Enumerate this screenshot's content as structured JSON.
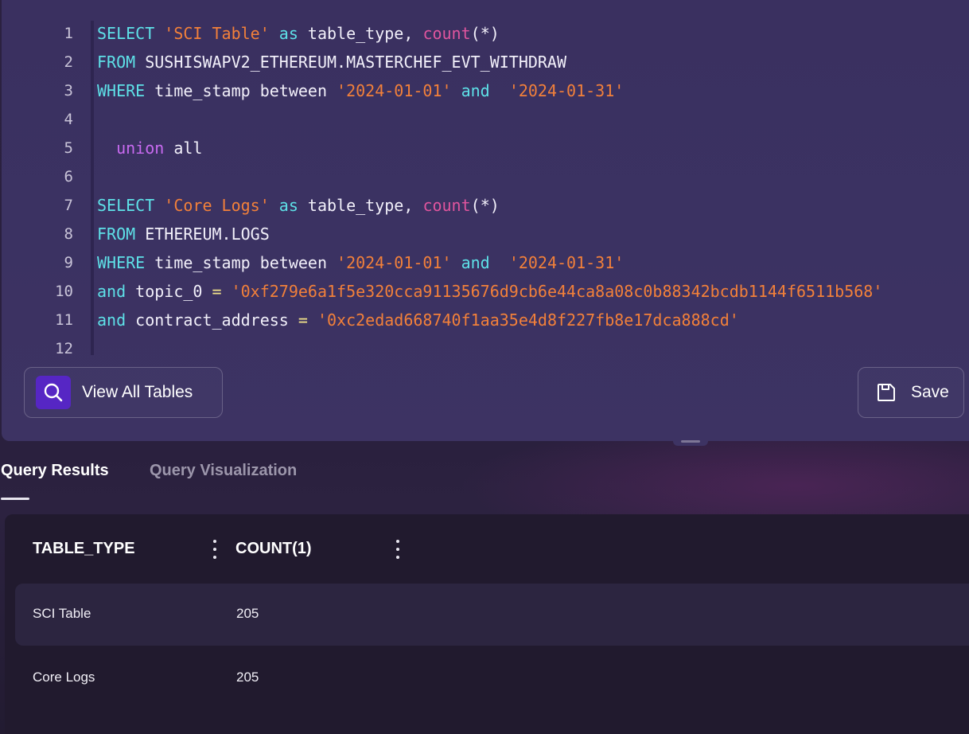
{
  "editor": {
    "lines": [
      {
        "n": "1",
        "tokens": [
          {
            "t": "SELECT",
            "c": "kw"
          },
          {
            "t": " "
          },
          {
            "t": "'SCI Table'",
            "c": "str"
          },
          {
            "t": " "
          },
          {
            "t": "as",
            "c": "kw"
          },
          {
            "t": " table_type, "
          },
          {
            "t": "count",
            "c": "fn"
          },
          {
            "t": "(*)"
          }
        ]
      },
      {
        "n": "2",
        "tokens": [
          {
            "t": "FROM",
            "c": "kw"
          },
          {
            "t": " SUSHISWAPV2_ETHEREUM.MASTERCHEF_EVT_WITHDRAW"
          }
        ]
      },
      {
        "n": "3",
        "tokens": [
          {
            "t": "WHERE",
            "c": "kw"
          },
          {
            "t": " time_stamp between "
          },
          {
            "t": "'2024-01-01'",
            "c": "str"
          },
          {
            "t": " "
          },
          {
            "t": "and",
            "c": "kw"
          },
          {
            "t": "  "
          },
          {
            "t": "'2024-01-31'",
            "c": "str"
          }
        ]
      },
      {
        "n": "4",
        "tokens": []
      },
      {
        "n": "5",
        "tokens": [
          {
            "t": "  "
          },
          {
            "t": "union",
            "c": "un"
          },
          {
            "t": " all"
          }
        ]
      },
      {
        "n": "6",
        "tokens": []
      },
      {
        "n": "7",
        "tokens": [
          {
            "t": "SELECT",
            "c": "kw"
          },
          {
            "t": " "
          },
          {
            "t": "'Core Logs'",
            "c": "str"
          },
          {
            "t": " "
          },
          {
            "t": "as",
            "c": "kw"
          },
          {
            "t": " table_type, "
          },
          {
            "t": "count",
            "c": "fn"
          },
          {
            "t": "(*)"
          }
        ]
      },
      {
        "n": "8",
        "tokens": [
          {
            "t": "FROM",
            "c": "kw"
          },
          {
            "t": " ETHEREUM.LOGS"
          }
        ]
      },
      {
        "n": "9",
        "tokens": [
          {
            "t": "WHERE",
            "c": "kw"
          },
          {
            "t": " time_stamp between "
          },
          {
            "t": "'2024-01-01'",
            "c": "str"
          },
          {
            "t": " "
          },
          {
            "t": "and",
            "c": "kw"
          },
          {
            "t": "  "
          },
          {
            "t": "'2024-01-31'",
            "c": "str"
          }
        ]
      },
      {
        "n": "10",
        "tokens": [
          {
            "t": "and",
            "c": "kw"
          },
          {
            "t": " topic_0 "
          },
          {
            "t": "=",
            "c": "op"
          },
          {
            "t": " "
          },
          {
            "t": "'0xf279e6a1f5e320cca91135676d9cb6e44ca8a08c0b88342bcdb1144f6511b568'",
            "c": "str"
          }
        ]
      },
      {
        "n": "11",
        "tokens": [
          {
            "t": "and",
            "c": "kw"
          },
          {
            "t": " contract_address "
          },
          {
            "t": "=",
            "c": "op"
          },
          {
            "t": " "
          },
          {
            "t": "'0xc2edad668740f1aa35e4d8f227fb8e17dca888cd'",
            "c": "str"
          }
        ]
      },
      {
        "n": "12",
        "tokens": []
      }
    ]
  },
  "toolbar": {
    "view_all_label": "View All Tables",
    "view_all_icon": "search-icon",
    "save_label": "Save",
    "save_icon": "floppy-disk-icon"
  },
  "tabs": {
    "results_label": "Query Results",
    "visualization_label": "Query Visualization",
    "active": "Query Results"
  },
  "results": {
    "columns": [
      "TABLE_TYPE",
      "COUNT(1)"
    ],
    "rows": [
      [
        "SCI Table",
        "205"
      ],
      [
        "Core Logs",
        "205"
      ]
    ]
  },
  "colors": {
    "keyword": "#5ee1e8",
    "string": "#f2803a",
    "function": "#e0559e",
    "union": "#c86af0",
    "accent": "#5626c4"
  }
}
